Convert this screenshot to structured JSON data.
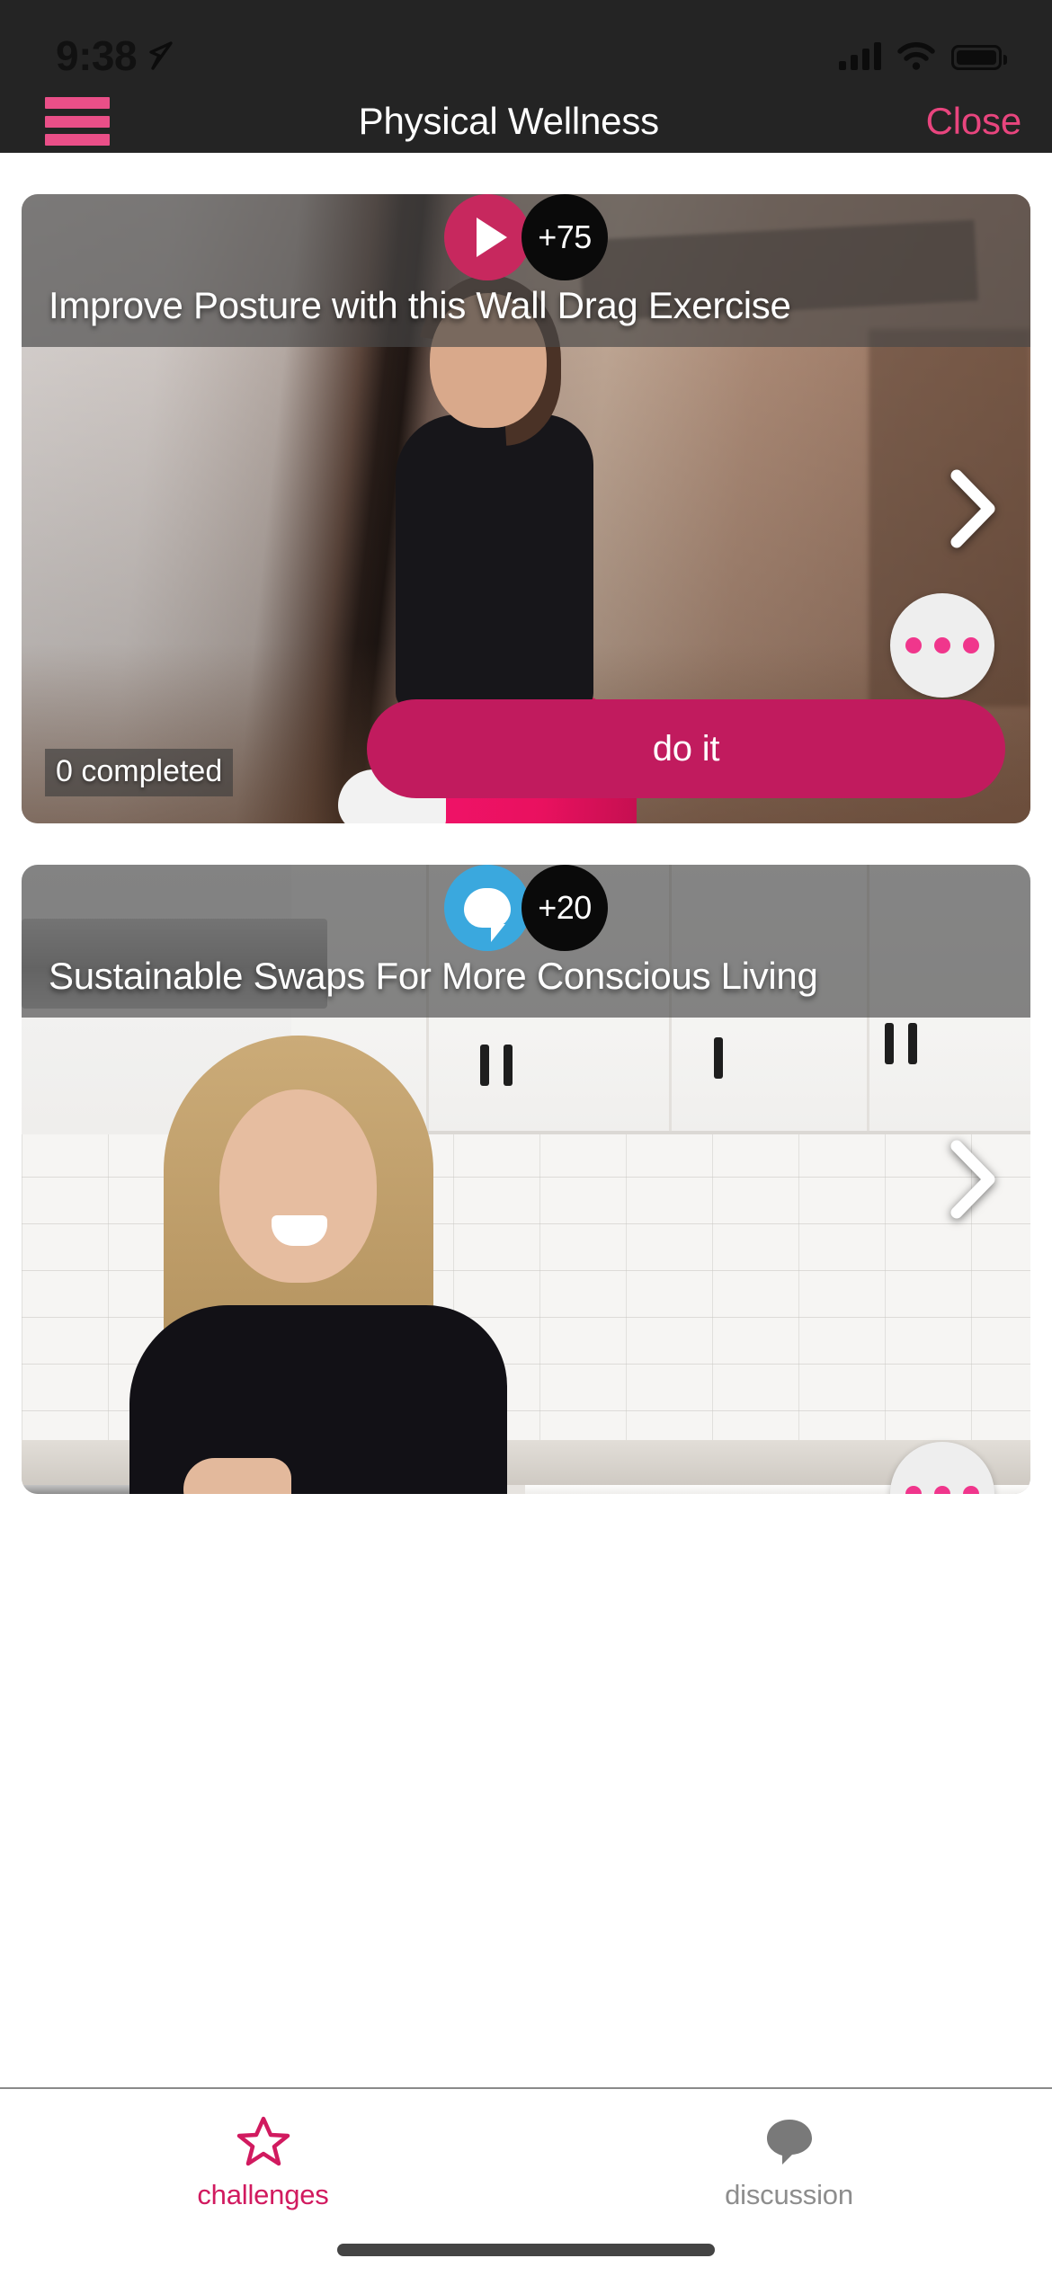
{
  "status_bar": {
    "time": "9:38",
    "location_icon": "location-arrow-icon",
    "cellular_icon": "cellular-signal-icon",
    "wifi_icon": "wifi-icon",
    "battery_icon": "battery-full-icon"
  },
  "nav": {
    "menu_icon": "hamburger-menu-icon",
    "title": "Physical Wellness",
    "close_label": "Close",
    "accent_color": "#E8457E"
  },
  "cards": [
    {
      "type": "video",
      "icon": "play-icon",
      "icon_color": "#C7285E",
      "points_badge": "+75",
      "title": "Improve Posture with this Wall Drag Exercise",
      "next_icon": "chevron-right-icon",
      "more_icon": "more-horizontal-icon",
      "action_label": "do it",
      "action_color": "#C11B5E",
      "completed_label": "0 completed"
    },
    {
      "type": "discussion",
      "icon": "chat-bubble-icon",
      "icon_color": "#3AA8DE",
      "points_badge": "+20",
      "title": "Sustainable Swaps For More Conscious Living",
      "next_icon": "chevron-right-icon",
      "more_icon": "more-horizontal-icon"
    }
  ],
  "tab_bar": {
    "tabs": [
      {
        "label": "challenges",
        "icon": "star-icon",
        "active": true,
        "color": "#D11A5F"
      },
      {
        "label": "discussion",
        "icon": "chat-bubble-icon",
        "active": false,
        "color": "#8d8d8d"
      }
    ]
  }
}
